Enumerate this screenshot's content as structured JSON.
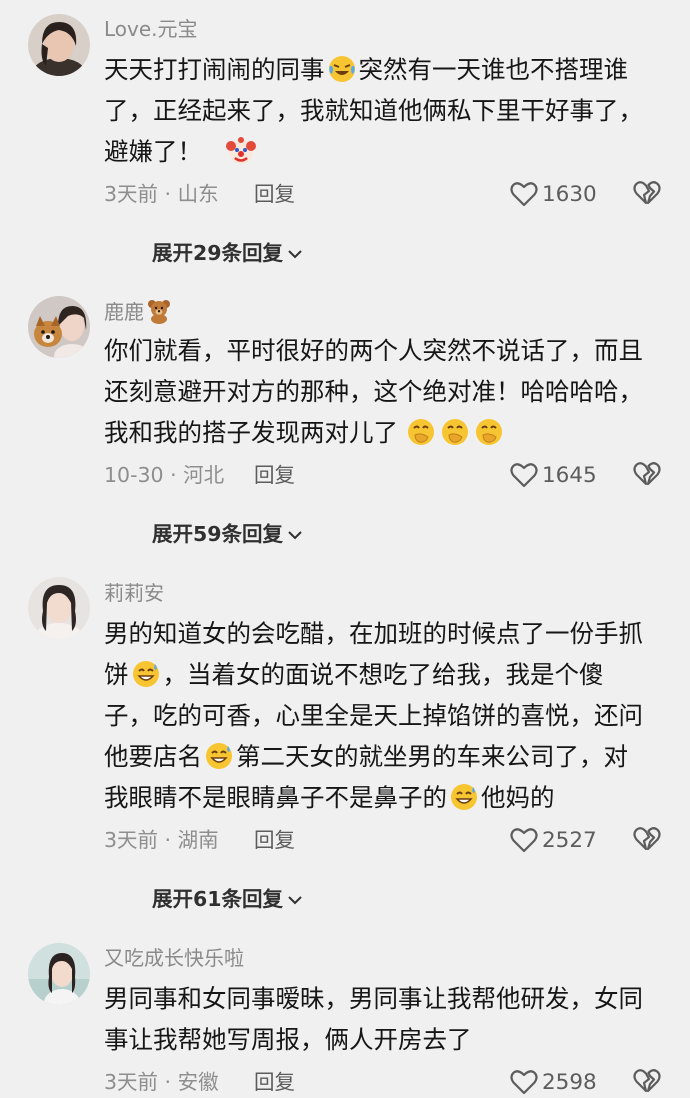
{
  "comments": [
    {
      "username": "Love.元宝",
      "lines": [
        {
          "before": "天天打打闹闹的同事",
          "emoji": "crying-laughing-emoji",
          "after": "突然有一天谁也不搭理谁"
        },
        {
          "before": "了，正经起来了，我就知道他俩私下里干好事了，",
          "emoji": "",
          "after": ""
        },
        {
          "before": "避嫌了！",
          "emoji": "clown-emoji",
          "after": ""
        }
      ],
      "time_location": "3天前 · 山东",
      "reply_label": "回复",
      "likes": "1630",
      "expand_label": "展开29条回复"
    },
    {
      "username": "鹿鹿",
      "username_icon": "teddy-bear-emoji",
      "lines": [
        {
          "before": "你们就看，平时很好的两个人突然不说话了，而且",
          "emoji": "",
          "after": ""
        },
        {
          "before": "还刻意避开对方的那种，这个绝对准！哈哈哈哈，",
          "emoji": "",
          "after": ""
        },
        {
          "before": "我和我的搭子发现两对儿了",
          "emoji": "hand-over-mouth-emoji",
          "after": ""
        }
      ],
      "time_location": "10-30 · 河北",
      "reply_label": "回复",
      "likes": "1645",
      "expand_label": "展开59条回复"
    },
    {
      "username": "莉莉安",
      "lines": [
        {
          "before": "男的知道女的会吃醋，在加班的时候点了一份手抓",
          "emoji": "",
          "after": ""
        },
        {
          "before": "饼",
          "emoji": "grinning-sweat-emoji",
          "after": "，当着女的面说不想吃了给我，我是个傻"
        },
        {
          "before": "子，吃的可香，心里全是天上掉馅饼的喜悦，还问",
          "emoji": "",
          "after": ""
        },
        {
          "before": "他要店名",
          "emoji": "grinning-sweat-emoji",
          "after": "第二天女的就坐男的车来公司了，对"
        },
        {
          "before": "我眼睛不是眼睛鼻子不是鼻子的",
          "emoji": "grinning-sweat-emoji",
          "after": "他妈的"
        }
      ],
      "time_location": "3天前 · 湖南",
      "reply_label": "回复",
      "likes": "2527",
      "expand_label": "展开61条回复"
    },
    {
      "username": "又吃成长快乐啦",
      "lines": [
        {
          "before": "男同事和女同事暧昧，男同事让我帮他研发，女同",
          "emoji": "",
          "after": ""
        },
        {
          "before": "事让我帮她写周报，俩人开房去了",
          "emoji": "",
          "after": ""
        }
      ],
      "time_location": "3天前 · 安徽",
      "reply_label": "回复",
      "likes": "2598"
    }
  ]
}
